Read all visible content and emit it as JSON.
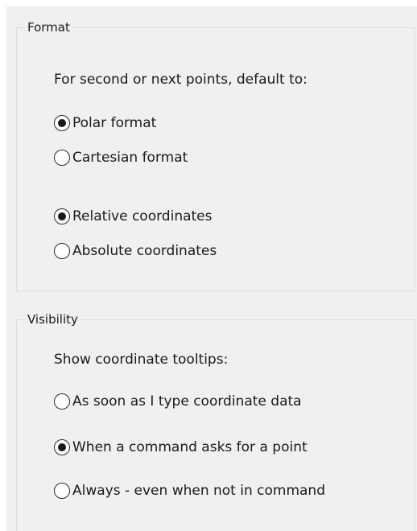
{
  "format": {
    "legend": "Format",
    "prompt": "For second or next points, default to:",
    "options_a": [
      {
        "label": "Polar format",
        "checked": true
      },
      {
        "label": "Cartesian format",
        "checked": false
      }
    ],
    "options_b": [
      {
        "label": "Relative coordinates",
        "checked": true
      },
      {
        "label": "Absolute coordinates",
        "checked": false
      }
    ]
  },
  "visibility": {
    "legend": "Visibility",
    "prompt": "Show coordinate tooltips:",
    "options": [
      {
        "label": "As soon as I type coordinate data",
        "checked": false
      },
      {
        "label": "When a command asks for a point",
        "checked": true
      },
      {
        "label": "Always - even when not in command",
        "checked": false
      }
    ]
  }
}
